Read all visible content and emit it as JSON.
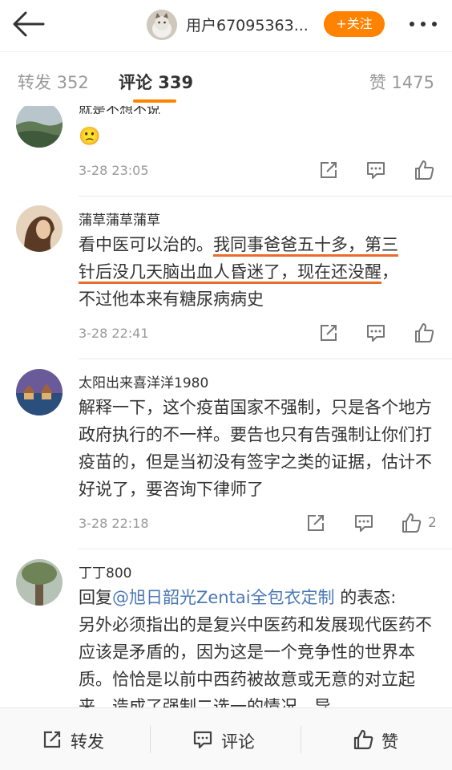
{
  "header": {
    "username": "用户67095363...",
    "follow_label": "+关注"
  },
  "tabs": {
    "repost": "转发 352",
    "comment": "评论 339",
    "like": "赞 1475"
  },
  "comments": [
    {
      "name": "",
      "text_partial": "就是不想不说",
      "emoji": "🙁",
      "time": "3-28 23:05",
      "like_count": ""
    },
    {
      "name": "蒲草蒲草蒲草",
      "text_a": "看中医可以治的。",
      "text_b": "我同事爸爸五十多，第三",
      "text_c": "针后没几天脑出血人昏迷了，现在还没醒",
      "text_d": "，",
      "text_e": "不过他本来有糖尿病病史",
      "time": "3-28 22:41",
      "like_count": ""
    },
    {
      "name": "太阳出来喜洋洋1980",
      "text": "解释一下，这个疫苗国家不强制，只是各个地方政府执行的不一样。要告也只有告强制让你们打疫苗的，但是当初没有签字之类的证据，估计不好说了，要咨询下律师了",
      "time": "3-28 22:18",
      "like_count": "2"
    },
    {
      "name": "丁丁800",
      "reply_prefix": "回复",
      "mention": "@旭日韶光Zentai全包衣定制",
      "reply_suffix": " 的表态:",
      "text": "另外必须指出的是复兴中医药和发展现代医药不应该是矛盾的，因为这是一个竞争性的世界本质。恰恰是以前中西药被故意或无意的对立起来，造成了强制二选一的情况，导"
    }
  ],
  "bottom": {
    "repost": "转发",
    "comment": "评论",
    "like": "赞"
  },
  "colors": {
    "accent": "#ff8200",
    "mention": "#4a78b5",
    "highlight_underline": "#e86c2d"
  }
}
